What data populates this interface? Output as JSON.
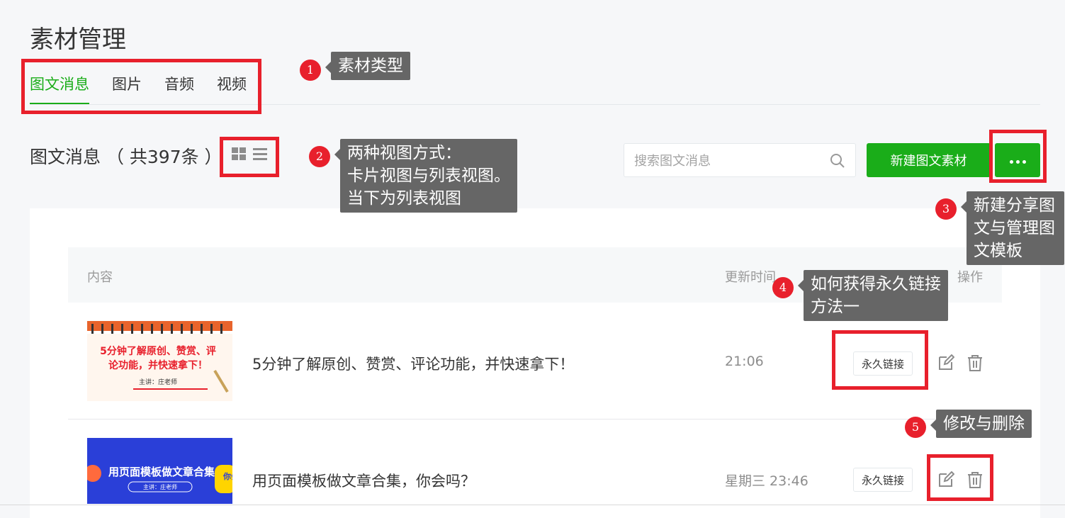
{
  "page": {
    "title": "素材管理"
  },
  "tabs": [
    {
      "label": "图文消息",
      "active": true
    },
    {
      "label": "图片",
      "active": false
    },
    {
      "label": "音频",
      "active": false
    },
    {
      "label": "视频",
      "active": false
    }
  ],
  "section": {
    "title": "图文消息 （ 共397条 ）"
  },
  "view_modes": [
    "card-view",
    "list-view"
  ],
  "search": {
    "placeholder": "搜索图文消息"
  },
  "toolbar": {
    "new_label": "新建图文素材",
    "more_icon": "more-dots-icon"
  },
  "table": {
    "columns": {
      "content": "内容",
      "updated": "更新时间",
      "actions": "操作"
    },
    "rows": [
      {
        "title": "5分钟了解原创、赞赏、评论功能，并快速拿下！",
        "time": "21:06",
        "link_label": "永久链接",
        "thumb": {
          "line1": "5分钟了解原创、赞赏、评",
          "line2": "论功能，并快速拿下！",
          "sub": "主讲：庄老师"
        }
      },
      {
        "title": "用页面模板做文章合集，你会吗？",
        "time": "星期三 23:46",
        "link_label": "永久链接",
        "thumb": {
          "line1": "用页面模板做文章合集",
          "sub": "主讲：庄老师",
          "badge": "你会吗？"
        }
      }
    ]
  },
  "annotations": [
    {
      "num": "1",
      "lines": [
        "素材类型"
      ]
    },
    {
      "num": "2",
      "lines": [
        "两种视图方式：",
        "卡片视图与列表视图。",
        "当下为列表视图"
      ]
    },
    {
      "num": "3",
      "lines": [
        "新建分享图",
        "文与管理图",
        "文模板"
      ]
    },
    {
      "num": "4",
      "lines": [
        "如何获得永久链接",
        "方法一"
      ]
    },
    {
      "num": "5",
      "lines": [
        "修改与删除"
      ]
    }
  ],
  "colors": {
    "accent": "#1aad19",
    "highlight": "#e8202c",
    "tooltip": "#666666"
  }
}
